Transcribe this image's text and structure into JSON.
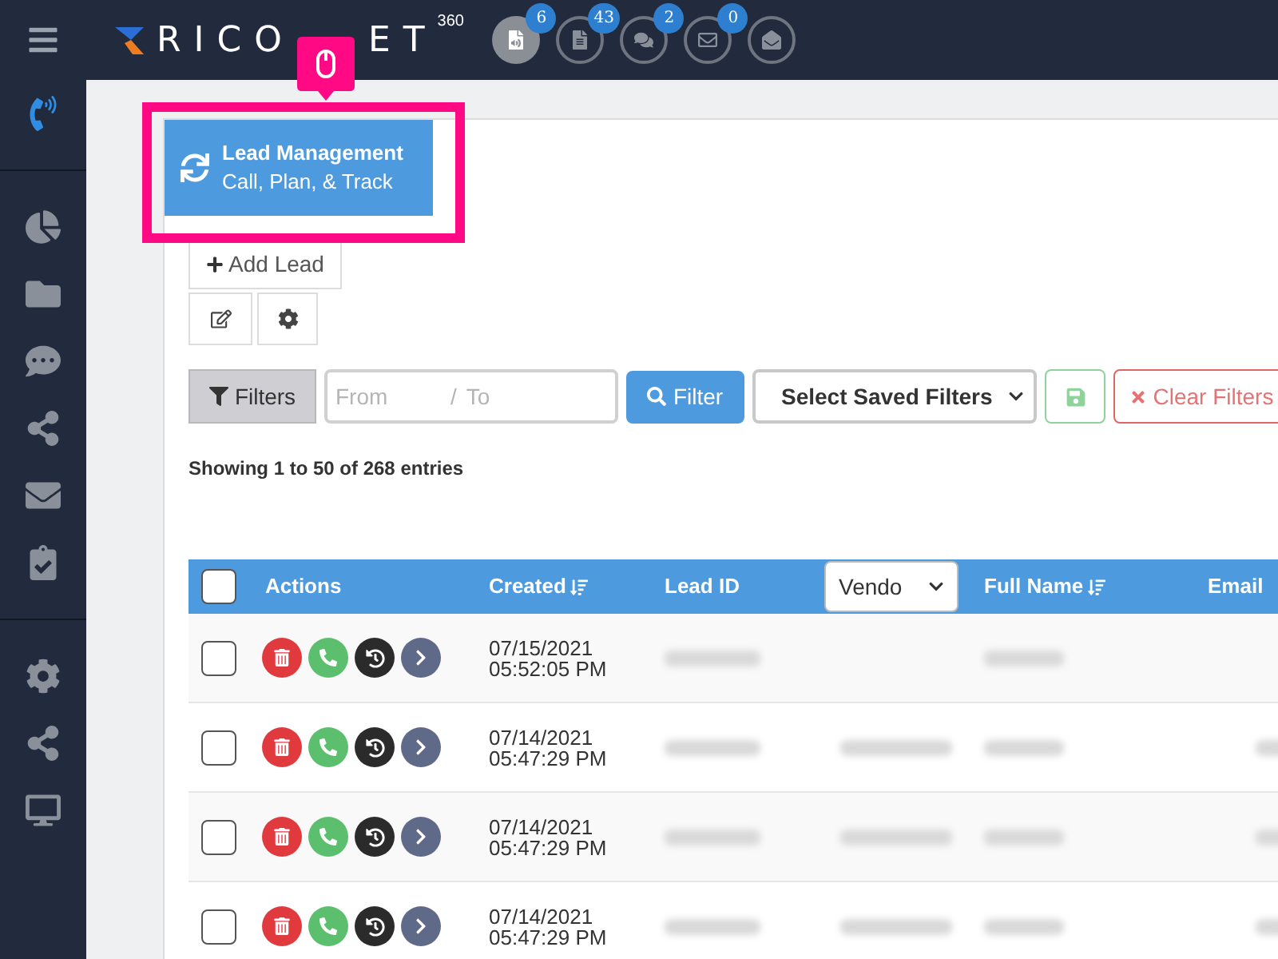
{
  "header": {
    "logo_start": "RICO",
    "logo_end": "ET",
    "logo_sup": "360",
    "notifications": [
      {
        "kind": "voicemail",
        "count": "6",
        "selected": true
      },
      {
        "kind": "file",
        "count": "43",
        "selected": false
      },
      {
        "kind": "chat",
        "count": "2",
        "selected": false
      },
      {
        "kind": "mail",
        "count": "0",
        "selected": false
      },
      {
        "kind": "inbox",
        "selected": false
      }
    ]
  },
  "sidebar": {
    "items": [
      {
        "kind": "dialpad",
        "selected": true
      },
      {
        "kind": "divider"
      },
      {
        "kind": "pie"
      },
      {
        "kind": "contacts"
      },
      {
        "kind": "chat"
      },
      {
        "kind": "share"
      },
      {
        "kind": "mail"
      },
      {
        "kind": "tasks"
      },
      {
        "kind": "divider"
      },
      {
        "kind": "settings"
      },
      {
        "kind": "share"
      },
      {
        "kind": "monitor"
      }
    ]
  },
  "tab": {
    "title": "Lead Management",
    "subtitle": "Call, Plan, & Track",
    "highlighted": true
  },
  "add_lead": "Add Lead",
  "filters": {
    "toggle": "Filters",
    "from_placeholder": "From",
    "separator": "/",
    "to_placeholder": "To",
    "filter_button": "Filter",
    "saved_filters": "Select Saved Filters",
    "clear": "Clear Filters"
  },
  "entries_info": "Showing 1 to 50 of 268 entries",
  "table": {
    "columns": [
      {
        "kind": "checkbox",
        "checked": false
      },
      {
        "kind": "text",
        "label": "Actions"
      },
      {
        "kind": "sort",
        "label": "Created"
      },
      {
        "kind": "text",
        "label": "Lead ID"
      },
      {
        "kind": "select",
        "label": "Vendo"
      },
      {
        "kind": "sort",
        "label": "Full Name"
      },
      {
        "kind": "text",
        "label": "Email"
      }
    ],
    "rows": [
      {
        "checked": false,
        "date": "07/15/2021",
        "time": "05:52:05 PM",
        "vendor_shown": false
      },
      {
        "checked": false,
        "date": "07/14/2021",
        "time": "05:47:29 PM",
        "vendor_shown": true
      },
      {
        "checked": false,
        "date": "07/14/2021",
        "time": "05:47:29 PM",
        "vendor_shown": true
      },
      {
        "checked": false,
        "date": "07/14/2021",
        "time": "05:47:29 PM",
        "vendor_shown": true
      }
    ]
  }
}
